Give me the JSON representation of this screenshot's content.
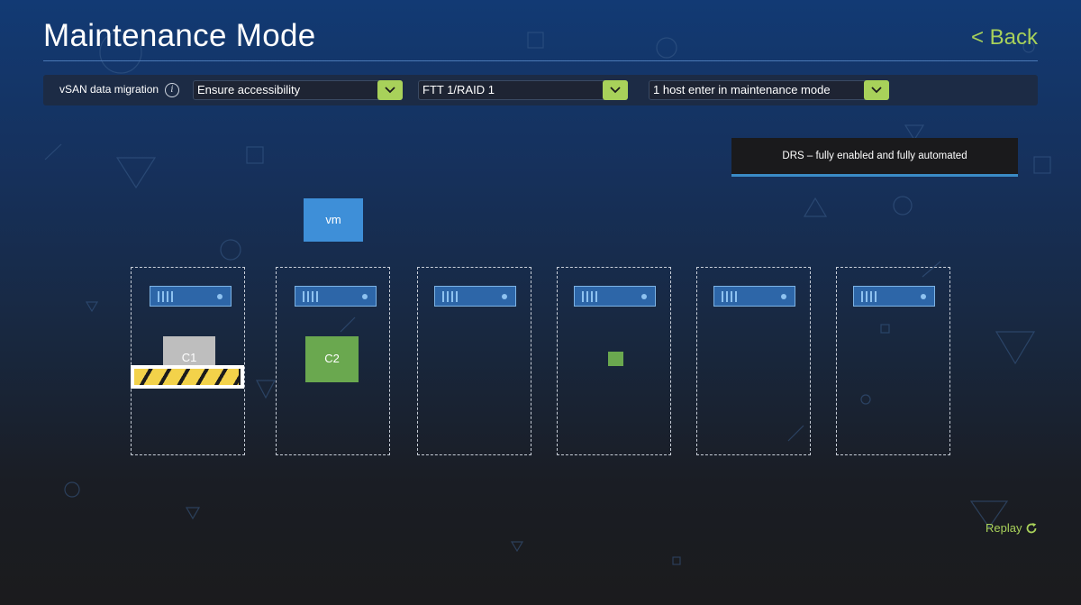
{
  "header": {
    "title": "Maintenance Mode",
    "back_label": "< Back"
  },
  "toolbar": {
    "label": "vSAN data migration",
    "info_icon": "info-icon",
    "selects": [
      {
        "value": "Ensure accessibility"
      },
      {
        "value": "FTT 1/RAID 1"
      },
      {
        "value": "1 host enter in maintenance mode"
      }
    ]
  },
  "banner": {
    "text": "DRS – fully enabled and fully automated"
  },
  "diagram": {
    "vm_label": "vm",
    "components": [
      {
        "label": "C1",
        "color": "#bebebe"
      },
      {
        "label": "C2",
        "color": "#6aa84f"
      }
    ],
    "migration_progress": 0.98,
    "host_count": 6
  },
  "footer": {
    "replay_label": "Replay",
    "replay_icon": "refresh-icon"
  },
  "colors": {
    "accent": "#a8d15a",
    "vm": "#3e8fd8",
    "progress": "#f3d24a",
    "banner_underline": "#3a8bc6"
  }
}
